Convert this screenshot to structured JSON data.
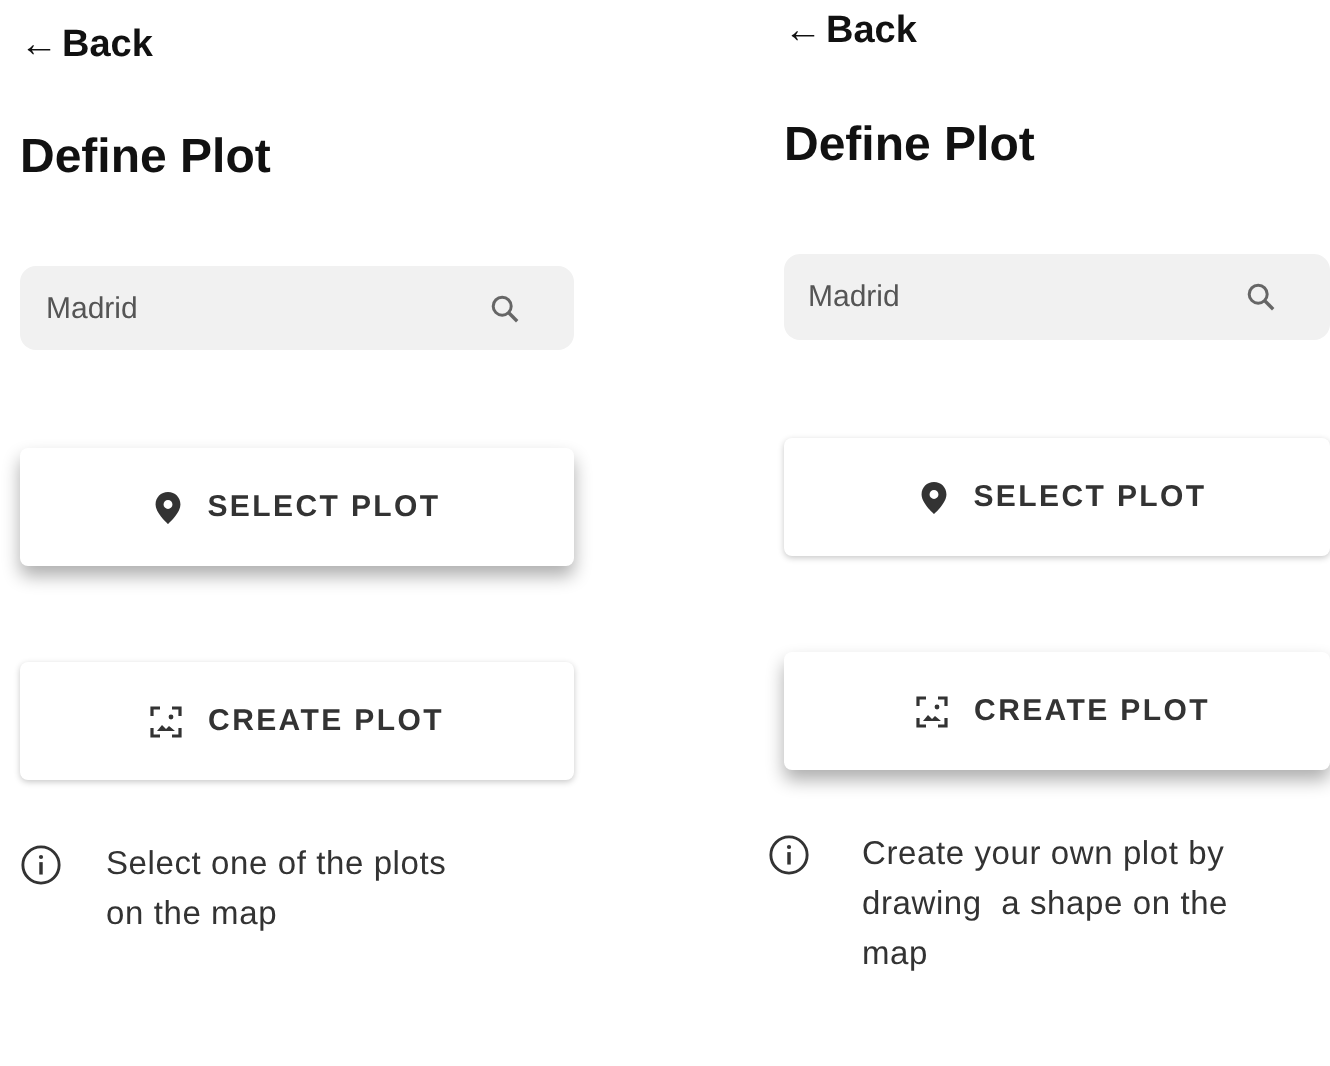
{
  "screens": [
    {
      "back": {
        "arrow": "←",
        "label": "Back"
      },
      "title": "Define Plot",
      "search": {
        "value": "Madrid"
      },
      "actions": [
        {
          "kind": "select",
          "label": "SELECT PLOT",
          "raised": true
        },
        {
          "kind": "create",
          "label": "CREATE PLOT",
          "raised": false
        }
      ],
      "info": [
        "Select one of the plots",
        "on the map"
      ]
    },
    {
      "back": {
        "arrow": "←",
        "label": "Back"
      },
      "title": "Define Plot",
      "search": {
        "value": "Madrid"
      },
      "actions": [
        {
          "kind": "select",
          "label": "SELECT PLOT",
          "raised": false
        },
        {
          "kind": "create",
          "label": "CREATE PLOT",
          "raised": true
        }
      ],
      "info": [
        "Create your own plot by",
        "drawing  a shape on the",
        "map"
      ]
    }
  ]
}
